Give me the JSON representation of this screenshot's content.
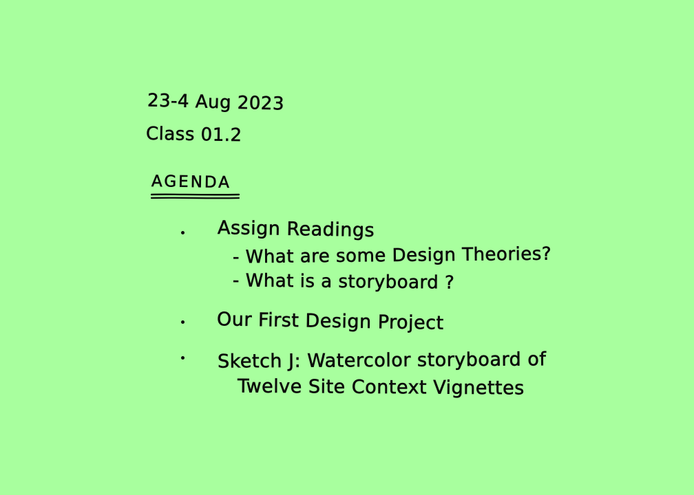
{
  "note": {
    "date": "23-4 Aug 2023",
    "class": "Class 01.2",
    "heading": "AGENDA",
    "items": [
      {
        "text": "Assign Readings",
        "subitems": [
          "- What are some Design Theories?",
          "- What is a storyboard ?"
        ]
      },
      {
        "text": "Our First Design Project"
      },
      {
        "text_line1": "Sketch J: Watercolor storyboard of",
        "text_line2": "Twelve Site Context Vignettes"
      }
    ],
    "colors": {
      "background": "#a8ff9e",
      "ink": "#0b0b0b"
    }
  }
}
